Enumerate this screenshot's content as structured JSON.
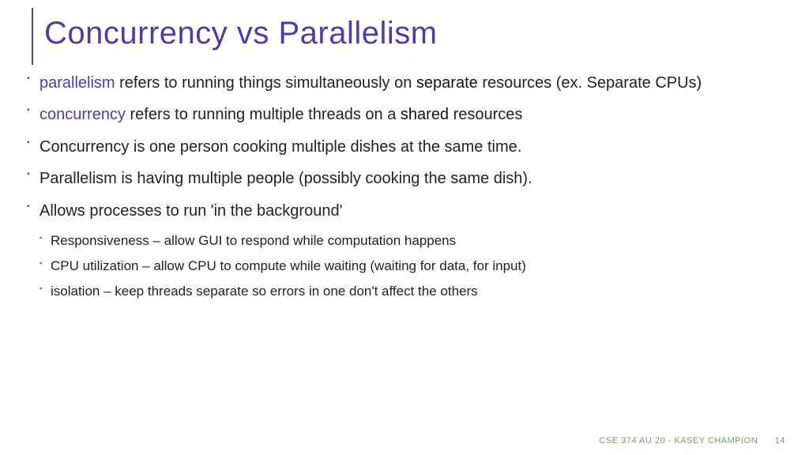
{
  "title": "Concurrency vs Parallelism",
  "bullets": [
    {
      "kw": "parallelism",
      "pre": "",
      "mid1": " refers to running things simultaneously on ",
      "bold": "separate",
      "post": " resources (ex. Separate CPUs)"
    },
    {
      "kw": "concurrency",
      "pre": "",
      "mid1": " refers to running multiple threads on a ",
      "bold": "shared",
      "post": " resources"
    },
    {
      "text": "Concurrency is one person cooking multiple dishes at the same time."
    },
    {
      "text": "Parallelism is having multiple people (possibly cooking the same dish)."
    },
    {
      "text": "Allows processes to run 'in the background'"
    }
  ],
  "subbullets": [
    "Responsiveness – allow GUI to respond while computation happens",
    "CPU utilization – allow CPU to compute while waiting (waiting for data, for input)",
    "isolation – keep threads separate so errors in one don't affect the others"
  ],
  "footer": {
    "course": "CSE 374 AU 20 - KASEY CHAMPION",
    "page": "14"
  }
}
